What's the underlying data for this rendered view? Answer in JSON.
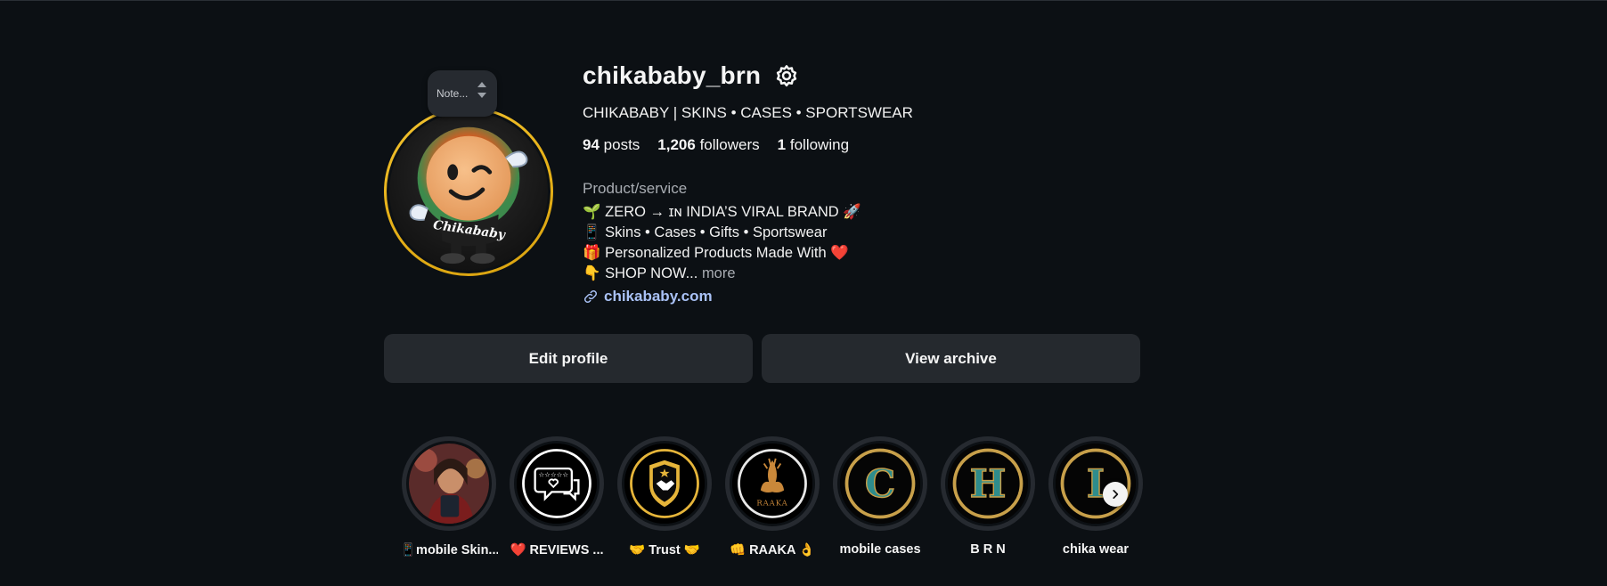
{
  "profile": {
    "username": "chikababy_brn",
    "full_name": "CHIKABABY | SKINS • CASES • SPORTSWEAR",
    "note_placeholder": "Note...",
    "stats": {
      "posts_count": "94",
      "posts_label": "posts",
      "followers_count": "1,206",
      "followers_label": "followers",
      "following_count": "1",
      "following_label": "following"
    },
    "category": "Product/service",
    "bio": [
      "🌱 ZERO → ɪɴ INDIA’S VIRAL BRAND 🚀",
      "📱 Skins • Cases • Gifts • Sportswear",
      "🎁 Personalized Products Made With ❤️",
      "👇 SHOP NOW..."
    ],
    "bio_more": "more",
    "website": "chikababy.com",
    "avatar_text": "Chikababy"
  },
  "actions": {
    "edit_profile": "Edit profile",
    "view_archive": "View archive"
  },
  "highlights": [
    {
      "label": "📱mobile Skin...",
      "cover": "photo"
    },
    {
      "label": "❤️ REVIEWS ...",
      "cover": "reviews-icon"
    },
    {
      "label": "🤝 Trust 🤝",
      "cover": "handshake-badge-icon"
    },
    {
      "label": "👊 RAAKA 👌",
      "cover": "raaka-logo",
      "cover_text": "RAAKA"
    },
    {
      "label": "mobile cases",
      "cover": "letter",
      "cover_text": "C"
    },
    {
      "label": "B R N",
      "cover": "letter",
      "cover_text": "H"
    },
    {
      "label": "chika wear",
      "cover": "letter",
      "cover_text": "I"
    }
  ],
  "colors": {
    "background": "#0c1014",
    "button": "#25292e",
    "link": "#a9c1f5",
    "story_ring": "#f1c232",
    "highlight_gold": "#c8a04a",
    "highlight_teal": "#2e8c8c"
  }
}
